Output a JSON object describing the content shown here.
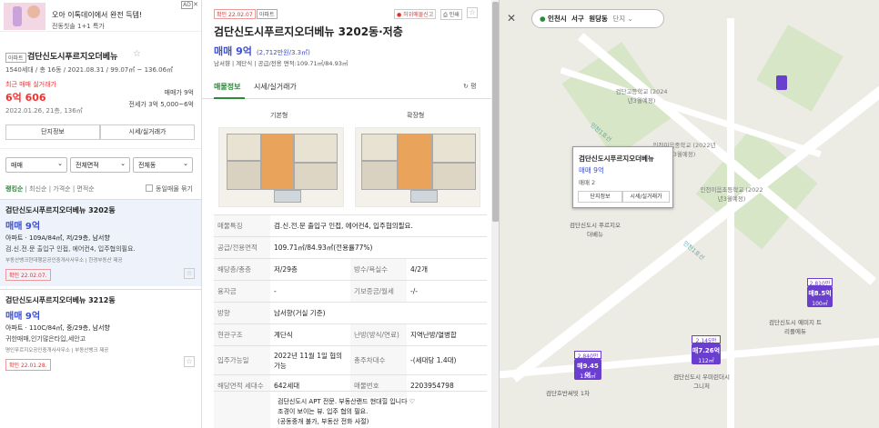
{
  "ad": {
    "badge": "AD",
    "text": "오아 이톡데이에서 완전 득템!",
    "subtext": "전동칫솔 1+1 특가"
  },
  "complex": {
    "type_badge": "아파트",
    "name": "검단신도시푸르지오더베뉴",
    "info": "1540세대 / 총 16동 / 2021.08.31 / 99.07㎡ ~ 136.06㎡",
    "recent_label": "최근 매매 실거래가",
    "recent_price": "6억 606",
    "recent_date": "2022.01.26, 21층, 136㎡",
    "sale_range": "매매가 9억",
    "rent_range": "전세가 3억 5,000~6억",
    "btn_info": "단지정보",
    "btn_price": "시세/실거래가"
  },
  "filters": {
    "trade": "매매",
    "area": "전체면적",
    "floor": "전체동"
  },
  "sort": {
    "items": [
      "랭킹순",
      "최신순",
      "가격순",
      "면적순"
    ],
    "same_toggle": "동일매물 묶기"
  },
  "listings": [
    {
      "title": "검단신도시푸르지오더베뉴 3202동",
      "price": "매매 9억",
      "spec": "아파트 · 109A/84㎡, 저/29층, 남서향",
      "desc": "검.신.전.문 출입구 인접, 에어컨4, 입주협의필요.",
      "agent": "부동산뱅크현대행운공인중개사사무소 | 한경부동산 제공",
      "date": "확인 22.02.07."
    },
    {
      "title": "검단신도시푸르지오더베뉴 3212동",
      "price": "매매 9억",
      "spec": "아파트 · 110C/84㎡, 중/29층, 남서향",
      "desc": "귀한매매,인기많은타입,세안고",
      "agent": "명인푸르지오공인중개사사무소 | 부동산뱅크 제공",
      "date": "확인 22.01.28."
    }
  ],
  "detail": {
    "confirm_tag": "확인 22.02.07",
    "type_tag": "아파트",
    "report": "허위매물신고",
    "print": "인쇄",
    "title": "검단신도시푸르지오더베뉴 3202동·저층",
    "price": "매매 9억",
    "price_sub": "(2,712만원/3.3㎡)",
    "summary": "남서향 | 계단식 | 공급/전용 면적:109.71㎡/84.93㎡",
    "tab1": "매물정보",
    "tab2": "시세/실거래가",
    "tab_right": "평",
    "plan1": "기본형",
    "plan2": "확장형",
    "rows": [
      {
        "l1": "매물특징",
        "v1": "검.신.전.문 출입구 인접, 에어컨4, 입주협의필요.",
        "full": true
      },
      {
        "l1": "공급/전용면적",
        "v1": "109.71㎡/84.93㎡(전용률77%)",
        "full": true
      },
      {
        "l1": "해당층/총층",
        "v1": "저/29층",
        "l2": "방수/욕실수",
        "v2": "4/2개"
      },
      {
        "l1": "융자금",
        "v1": "-",
        "l2": "기보증금/월세",
        "v2": "-/-"
      },
      {
        "l1": "방향",
        "v1": "남서향(거실 기준)",
        "full": true
      },
      {
        "l1": "현관구조",
        "v1": "계단식",
        "l2": "난방(방식/연료)",
        "v2": "지역난방/열병합"
      },
      {
        "l1": "입주가능일",
        "v1": "2022년 11월 1일 협의가능",
        "l2": "총주차대수",
        "v2": "-(세대당 1.4대)"
      },
      {
        "l1": "해당면적 세대수",
        "v1": "642세대",
        "l2": "매물번호",
        "v2": "2203954798"
      }
    ],
    "note": [
      "검단신도시 APT 전문. 부동산랜드 현대힐 입니다 ♡",
      "조경이 보이는 뷰. 입주 협의 필요.",
      "(공동중개 불가, 부동산 전화 사절)"
    ]
  },
  "map": {
    "region": [
      "인천시",
      "서구",
      "원당동",
      "단지"
    ],
    "popup": {
      "title": "검단신도시푸르지오더베뉴",
      "price": "매매 9억",
      "sub": "매매 2",
      "b1": "단지정보",
      "b2": "시세/실거래가"
    },
    "markers": [
      {
        "top": "2,810만",
        "price": "매8.5억",
        "area": "100㎡"
      },
      {
        "top": "2,145만",
        "price": "매7.26억",
        "area": "112㎡"
      },
      {
        "top": "2,840만",
        "price": "매9.45억",
        "area": "110㎡"
      }
    ],
    "labels": [
      "검단고등학교 (2024년3월예정)",
      "인천이음중학교 (2022년3월예정)",
      "인천이음초등학교 (2022년3월예정)",
      "검단신도시 푸르지오더베뉴",
      "검단호반써밋 1차",
      "검단신도시 우미린더시그니처",
      "검단신도시 예미지 트리플에듀"
    ],
    "lines": [
      "인천1호선",
      "인천1호선"
    ]
  }
}
